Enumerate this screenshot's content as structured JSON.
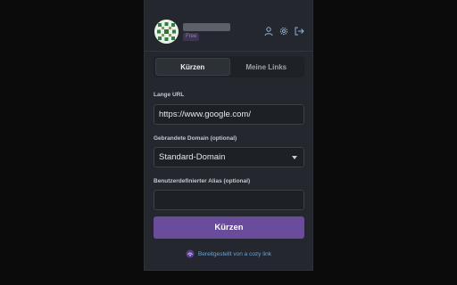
{
  "header": {
    "plan_badge": "Free",
    "icons": [
      "avatar-image",
      "user-icon",
      "gear-icon",
      "logout-icon"
    ]
  },
  "tabs": [
    {
      "label": "Kürzen",
      "active": true
    },
    {
      "label": "Meine Links",
      "active": false
    }
  ],
  "form": {
    "long_url_label": "Lange URL",
    "long_url_value": "https://www.google.com/",
    "domain_label": "Gebrandete Domain (optional)",
    "domain_value": "Standard-Domain",
    "alias_label": "Benutzerdefinierter Alias (optional)",
    "alias_value": "",
    "submit_label": "Kürzen"
  },
  "footer": {
    "text": "Bereitgestellt von a cozy link"
  },
  "colors": {
    "accent": "#6a4c9c",
    "panel_bg": "#24272d",
    "link": "#6da2d6"
  }
}
